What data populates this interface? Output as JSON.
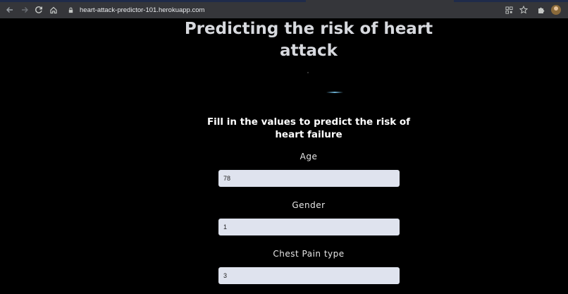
{
  "browser": {
    "url": "heart-attack-predictor-101.herokuapp.com",
    "icons": [
      "back-icon",
      "forward-icon",
      "reload-icon",
      "home-icon",
      "lock-icon",
      "qr-code-icon",
      "star-icon",
      "extensions-icon",
      "profile-avatar"
    ]
  },
  "page": {
    "title": "Predicting the risk of heart attack",
    "subtitle": "Fill in the values to predict the risk of heart failure",
    "fields": [
      {
        "label": "Age",
        "value": "78"
      },
      {
        "label": "Gender",
        "value": "1"
      },
      {
        "label": "Chest Pain type",
        "value": "3"
      }
    ]
  }
}
